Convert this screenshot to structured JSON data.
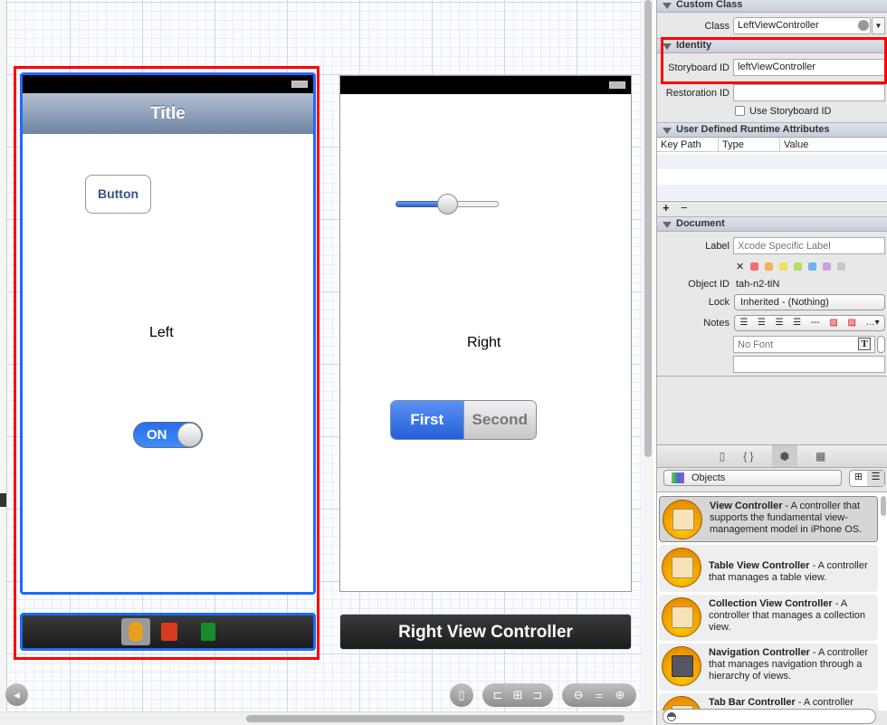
{
  "canvas": {
    "left_scene": {
      "nav_title": "Title",
      "button_label": "Button",
      "label": "Left",
      "switch_label": "ON",
      "switch_on": true,
      "dock_icons": [
        "view-controller-icon",
        "first-responder-icon",
        "exit-icon"
      ]
    },
    "right_scene": {
      "label": "Right",
      "slider_value": 0.5,
      "segments": [
        "First",
        "Second"
      ],
      "selected_segment": "First",
      "dock_title": "Right View Controller"
    },
    "bottom_controls": [
      "toggle-outline-icon",
      "form-factor-icon",
      "align-left-icon",
      "pin-icon",
      "resize-icon",
      "zoom-out-icon",
      "zoom-actual-icon",
      "zoom-in-icon"
    ]
  },
  "inspector": {
    "custom_class": {
      "header": "Custom Class",
      "class_label": "Class",
      "class_value": "LeftViewController"
    },
    "identity": {
      "header": "Identity",
      "storyboard_id_label": "Storyboard ID",
      "storyboard_id_value": "leftViewController",
      "restoration_id_label": "Restoration ID",
      "restoration_id_value": "",
      "use_storyboard_id_label": "Use Storyboard ID",
      "use_storyboard_id_checked": false
    },
    "runtime_attrs": {
      "header": "User Defined Runtime Attributes",
      "columns": [
        "Key Path",
        "Type",
        "Value"
      ],
      "add": "+",
      "remove": "−"
    },
    "document": {
      "header": "Document",
      "label_label": "Label",
      "label_placeholder": "Xcode Specific Label",
      "label_colors": [
        "#f07070",
        "#f5b060",
        "#eee060",
        "#b8dc60",
        "#70b0f0",
        "#c8a0e0",
        "#c8c8c8"
      ],
      "object_id_label": "Object ID",
      "object_id_value": "tah-n2-tiN",
      "lock_label": "Lock",
      "lock_value": "Inherited - (Nothing)",
      "notes_label": "Notes",
      "font_placeholder": "No Font"
    },
    "library_tabs": [
      "file-template-icon",
      "code-snippet-icon",
      "object-library-icon",
      "media-library-icon"
    ],
    "library_filter": "Objects",
    "library_items": [
      {
        "title": "View Controller",
        "desc": " - A controller that supports the fundamental view-management model in iPhone OS."
      },
      {
        "title": "Table View Controller",
        "desc": " - A controller that manages a table view."
      },
      {
        "title": "Collection View Controller",
        "desc": " - A controller that manages a collection view."
      },
      {
        "title": "Navigation Controller",
        "desc": " - A controller that manages navigation through a hierarchy of views."
      },
      {
        "title": "Tab Bar Controller",
        "desc": " - A controller"
      }
    ]
  },
  "colors": {
    "selection_blue": "#1a6cff",
    "highlight_red": "#ff0000",
    "ios_blue": "#2a6ee8"
  }
}
